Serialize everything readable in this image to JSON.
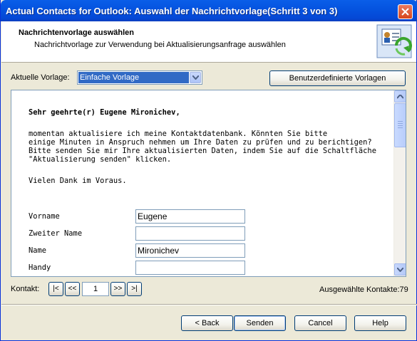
{
  "window": {
    "title": "Actual Contacts for Outlook: Auswahl der Nachrichtvorlage(Schritt 3 von 3)"
  },
  "header": {
    "title": "Nachrichtenvorlage auswählen",
    "subtitle": "Nachrichtvorlage zur Verwendung bei Aktualisierungsanfrage auswählen",
    "icon": "contact-card-refresh-icon"
  },
  "template": {
    "label": "Aktuelle Vorlage:",
    "selected": "Einfache Vorlage",
    "custom_button": "Benutzerdefinierte Vorlagen"
  },
  "message": {
    "greeting": "Sehr geehrte(r) Eugene Mironichev,",
    "lines": [
      "momentan aktualisiere ich meine Kontaktdatenbank. Könnten Sie bitte",
      "einige Minuten in Anspruch nehmen um Ihre Daten zu prüfen und zu berichtigen?",
      "Bitte senden Sie mir Ihre aktualisierten Daten, indem Sie auf die Schaltfläche",
      "\"Aktualisierung senden\" klicken."
    ],
    "thanks": "Vielen Dank im Voraus.",
    "fields": [
      {
        "label": "Vorname",
        "value": "Eugene"
      },
      {
        "label": "Zweiter Name",
        "value": ""
      },
      {
        "label": "Name",
        "value": "Mironichev"
      },
      {
        "label": "Handy",
        "value": ""
      }
    ]
  },
  "navigation": {
    "label": "Kontakt:",
    "first": "|<",
    "prev": "<<",
    "page": "1",
    "next": ">>",
    "last": ">|",
    "selected_label": "Ausgewählte Kontakte:79"
  },
  "footer": {
    "back": "< Back",
    "send": "Senden",
    "cancel": "Cancel",
    "help": "Help"
  }
}
